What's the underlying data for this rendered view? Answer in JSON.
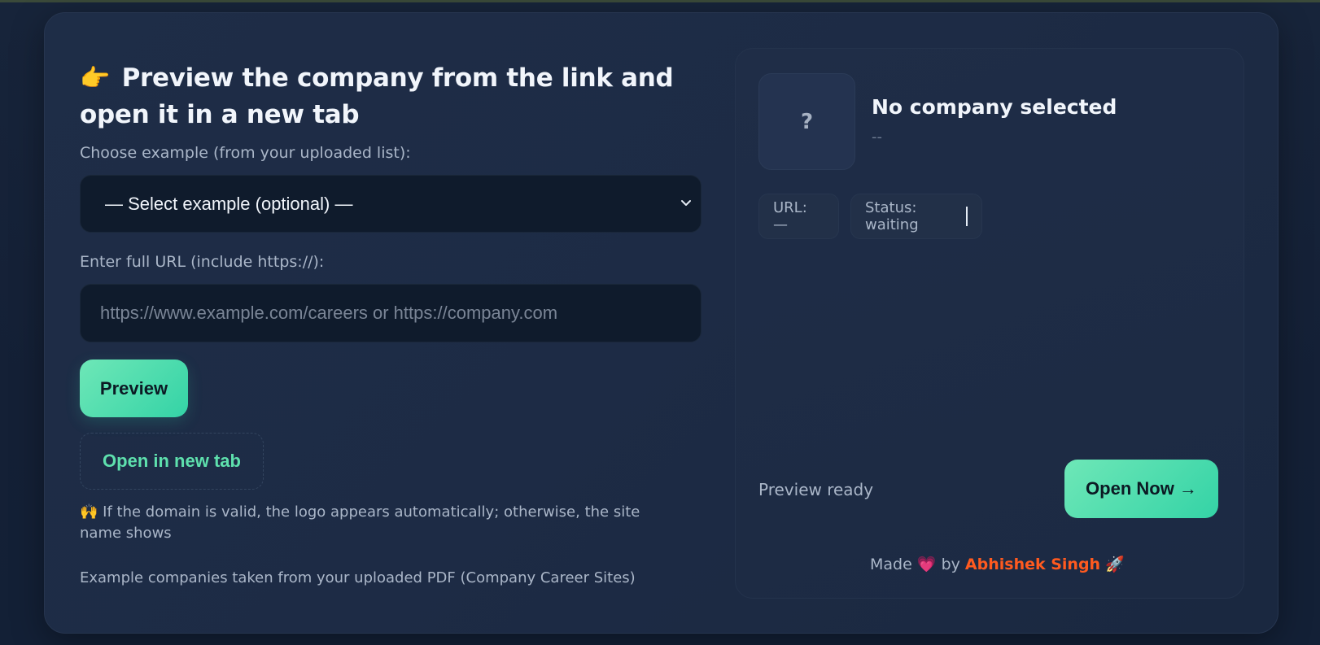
{
  "header": {
    "title_emoji": "👉",
    "title": "Preview the company from the link and open it in a new tab"
  },
  "form": {
    "select_label": "Choose example (from your uploaded list):",
    "select_value": "— Select example (optional) —",
    "url_label": "Enter full URL (include https://):",
    "url_placeholder": "https://www.example.com/careers or https://company.com",
    "preview_button": "Preview",
    "open_new_tab_button": "Open in new tab",
    "note_emoji": "🙌",
    "note": "If the domain is valid, the logo appears automatically; otherwise, the site name shows",
    "footnote": "Example companies taken from your uploaded PDF (Company Career Sites)"
  },
  "preview": {
    "logo_placeholder": "?",
    "company_name": "No company selected",
    "company_sub": "--",
    "url_chip": "URL: —",
    "status_chip": "Status: waiting",
    "ready_text": "Preview ready",
    "open_now_button": "Open Now →"
  },
  "footer": {
    "made_prefix": "Made",
    "heart": "💗",
    "by": "by",
    "author": "Abhishek Singh",
    "rocket": "🚀"
  },
  "colors": {
    "accent": "#34d3a6",
    "accent_light": "#6ee7b7",
    "author": "#ff5a1f",
    "background": "#141f33"
  }
}
